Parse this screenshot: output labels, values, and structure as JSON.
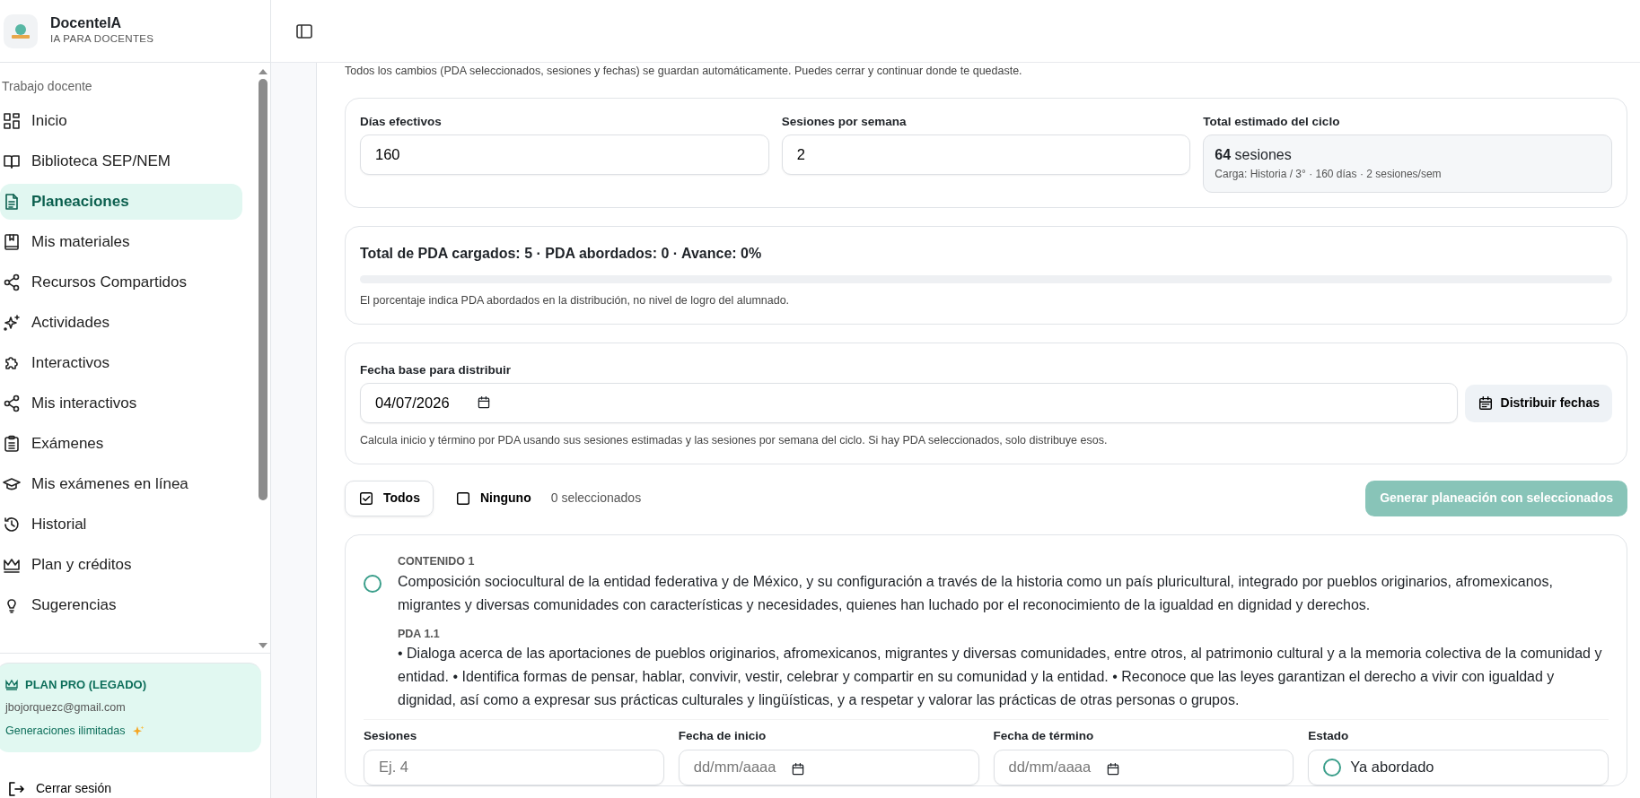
{
  "brand": {
    "name": "DocenteIA",
    "tagline": "IA PARA DOCENTES"
  },
  "sidebar": {
    "section": "Trabajo docente",
    "items": [
      {
        "label": "Inicio",
        "selected": false
      },
      {
        "label": "Biblioteca SEP/NEM",
        "selected": false
      },
      {
        "label": "Planeaciones",
        "selected": true
      },
      {
        "label": "Mis materiales",
        "selected": false
      },
      {
        "label": "Recursos Compartidos",
        "selected": false
      },
      {
        "label": "Actividades",
        "selected": false
      },
      {
        "label": "Interactivos",
        "selected": false
      },
      {
        "label": "Mis interactivos",
        "selected": false
      },
      {
        "label": "Exámenes",
        "selected": false
      },
      {
        "label": "Mis exámenes en línea",
        "selected": false
      },
      {
        "label": "Historial",
        "selected": false
      },
      {
        "label": "Plan y créditos",
        "selected": false
      },
      {
        "label": "Sugerencias",
        "selected": false
      }
    ]
  },
  "plan": {
    "title": "PLAN PRO (LEGADO)",
    "email": "jbojorquezc@gmail.com",
    "note": "Generaciones ilimitadas"
  },
  "logout": "Cerrar sesión",
  "notice": "Todos los cambios (PDA seleccionados, sesiones y fechas) se guardan automáticamente. Puedes cerrar y continuar donde te quedaste.",
  "settings": {
    "fields": [
      {
        "label": "Días efectivos",
        "value": "160"
      },
      {
        "label": "Sesiones por semana",
        "value": "2"
      }
    ],
    "total": {
      "label": "Total estimado del ciclo",
      "count": "64",
      "unit": "sesiones",
      "detail": "Carga: Historia / 3° · 160 días · 2 sesiones/sem"
    }
  },
  "progress": {
    "summary": "Total de PDA cargados: 5 · PDA abordados: 0 · Avance: 0%",
    "level": 0,
    "note": "El porcentaje indica PDA abordados en la distribución, no nivel de logro del alumnado."
  },
  "distribution": {
    "label": "Fecha base para distribuir",
    "value": "04/07/2026",
    "button": "Distribuir fechas",
    "hint": "Calcula inicio y término por PDA usando sus sesiones estimadas y las sesiones por semana del ciclo. Si hay PDA seleccionados, solo distribuye esos."
  },
  "selection": {
    "all": {
      "label": "Todos",
      "checked": true
    },
    "none": {
      "label": "Ninguno",
      "checked": false
    },
    "count": "0 seleccionados",
    "generate": {
      "label": "Generar planeación con seleccionados",
      "disabled": true
    }
  },
  "contents": [
    {
      "heading": "CONTENIDO 1",
      "selected": false,
      "text": "Composición sociocultural de la entidad federativa y de México, y su configuración a través de la historia como un país pluricultural, integrado por pueblos originarios, afromexicanos, migrantes y diversas comunidades con características y necesidades, quienes han luchado por el reconocimiento de la igualdad en dignidad y derechos.",
      "pda_label": "PDA 1.1",
      "pda_text": "• Dialoga acerca de las aportaciones de pueblos originarios, afromexicanos, migrantes y diversas comunidades, entre otros, al patrimonio cultural y a la memoria colectiva de la comunidad y entidad. • Identifica formas de pensar, hablar, convivir, vestir, celebrar y compartir en su comunidad y la entidad. • Reconoce que las leyes garantizan el derecho a vivir con igualdad y dignidad, así como a expresar sus prácticas culturales y lingüísticas, y a respetar y valorar las prácticas de otras personas o grupos.",
      "fields": [
        {
          "label": "Sesiones",
          "placeholder": "Ej. 4",
          "kind": "text"
        },
        {
          "label": "Fecha de inicio",
          "placeholder": "dd/mm/aaaa",
          "kind": "date"
        },
        {
          "label": "Fecha de término",
          "placeholder": "dd/mm/aaaa",
          "kind": "date"
        }
      ],
      "status": {
        "label": "Estado",
        "option": "Ya abordado",
        "checked": false
      }
    }
  ]
}
